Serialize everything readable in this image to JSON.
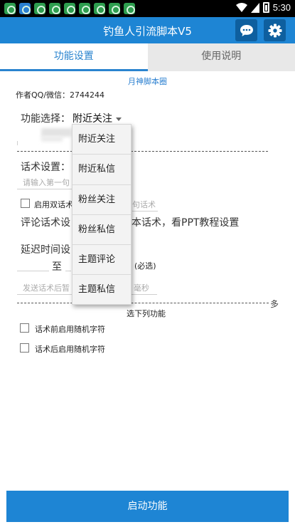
{
  "status_bar": {
    "app_icons": [
      "green-app-icon",
      "blue-app-icon",
      "green-app-icon",
      "green-app-icon",
      "green-app-icon",
      "green-app-icon",
      "green-app-icon",
      "green-app-icon",
      "green-app-icon"
    ],
    "time": "5:30"
  },
  "header": {
    "title": "钓鱼人引流脚本V5",
    "chat_icon": "chat-bubble-icon",
    "settings_icon": "gear-icon"
  },
  "tabs": [
    {
      "label": "功能设置",
      "active": true
    },
    {
      "label": "使用说明",
      "active": false
    }
  ],
  "main": {
    "banner_link": "月神脚本圈",
    "author": "作者QQ/微信：2744244",
    "function_select": {
      "label": "功能选择：",
      "value": "附近关注",
      "options": [
        "附近关注",
        "附近私信",
        "粉丝关注",
        "粉丝私信",
        "主题评论",
        "主题私信"
      ]
    },
    "script_settings": {
      "label": "话术设置：",
      "placeholder": "请输入第一句",
      "dual_checkbox_label": "启用双话术",
      "dual_placeholder_tail": "句话术"
    },
    "comment_text": {
      "label_start": "评论话术设",
      "label_end": "本话术，看PPT教程设置"
    },
    "delay": {
      "label": "延迟时间设",
      "to": "至",
      "required_suffix": "(必选)",
      "send_placeholder": "发送话术后暂",
      "ms_suffix": "毫秒"
    },
    "multi_select": {
      "more_label": "多",
      "caption": "选下列功能",
      "options": [
        {
          "label": "话术前启用随机字符",
          "checked": false
        },
        {
          "label": "话术后启用随机字符",
          "checked": false
        }
      ]
    },
    "start_button": "启动功能"
  }
}
